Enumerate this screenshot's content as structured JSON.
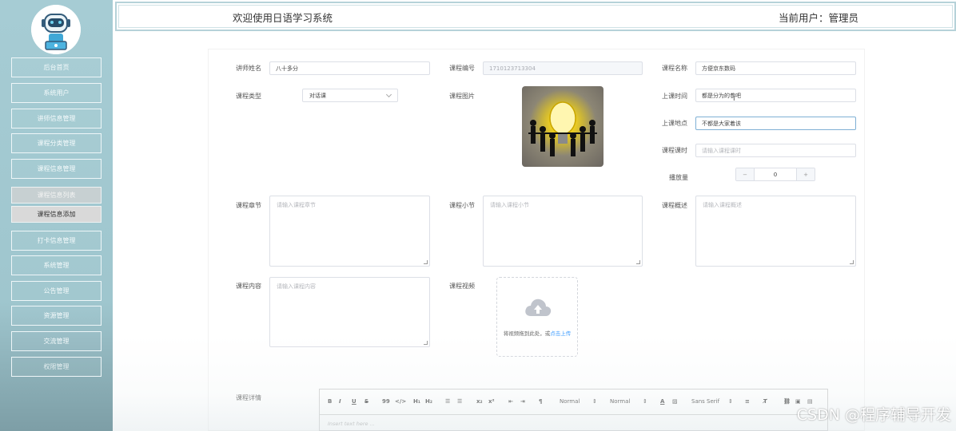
{
  "header": {
    "welcome": "欢迎使用日语学习系统",
    "current_user": "当前用户：管理员"
  },
  "sidebar": {
    "items": [
      {
        "label": "后台首页"
      },
      {
        "label": "系统用户"
      },
      {
        "label": "讲师信息管理"
      },
      {
        "label": "课程分类管理"
      },
      {
        "label": "课程信息管理"
      }
    ],
    "sub_items": [
      {
        "label": "课程信息列表"
      },
      {
        "label": "课程信息添加"
      }
    ],
    "items_after": [
      {
        "label": "打卡信息管理"
      },
      {
        "label": "系统管理"
      },
      {
        "label": "公告管理"
      },
      {
        "label": "资源管理"
      },
      {
        "label": "交流管理"
      },
      {
        "label": "权限管理"
      }
    ]
  },
  "form": {
    "teacher_name": {
      "label": "讲师姓名",
      "value": "八十多分"
    },
    "course_no": {
      "label": "课程编号",
      "value": "1710123713304"
    },
    "course_name": {
      "label": "课程名称",
      "value": "方便京东数码"
    },
    "course_type": {
      "label": "课程类型",
      "value": "对话课"
    },
    "course_image": {
      "label": "课程图片"
    },
    "class_time": {
      "label": "上课时间",
      "value": "都是分为的参吧"
    },
    "class_place": {
      "label": "上课地点",
      "value": "不都是大家着该"
    },
    "course_hours": {
      "label": "课程课时",
      "placeholder": "请输入课程课时"
    },
    "play_count": {
      "label": "播放量",
      "value": "0",
      "minus": "−",
      "plus": "+"
    },
    "chapter": {
      "label": "课程章节",
      "placeholder": "请输入课程章节"
    },
    "section": {
      "label": "课程小节",
      "placeholder": "请输入课程小节"
    },
    "overview": {
      "label": "课程概述",
      "placeholder": "请输入课程概述"
    },
    "content": {
      "label": "课程内容",
      "placeholder": "请输入课程内容"
    },
    "video": {
      "label": "课程视频",
      "upload_text": "将视频拖到此处，或",
      "upload_link": "点击上传"
    },
    "details": {
      "label": "课程详情"
    }
  },
  "editor": {
    "normal_1": "Normal",
    "normal_2": "Normal",
    "font": "Sans Serif",
    "placeholder": "Insert text here ..."
  },
  "watermark": "CSDN @程序辅导开发",
  "colors": {
    "sidebar": "#a6ccd4",
    "accent": "#409eff"
  }
}
